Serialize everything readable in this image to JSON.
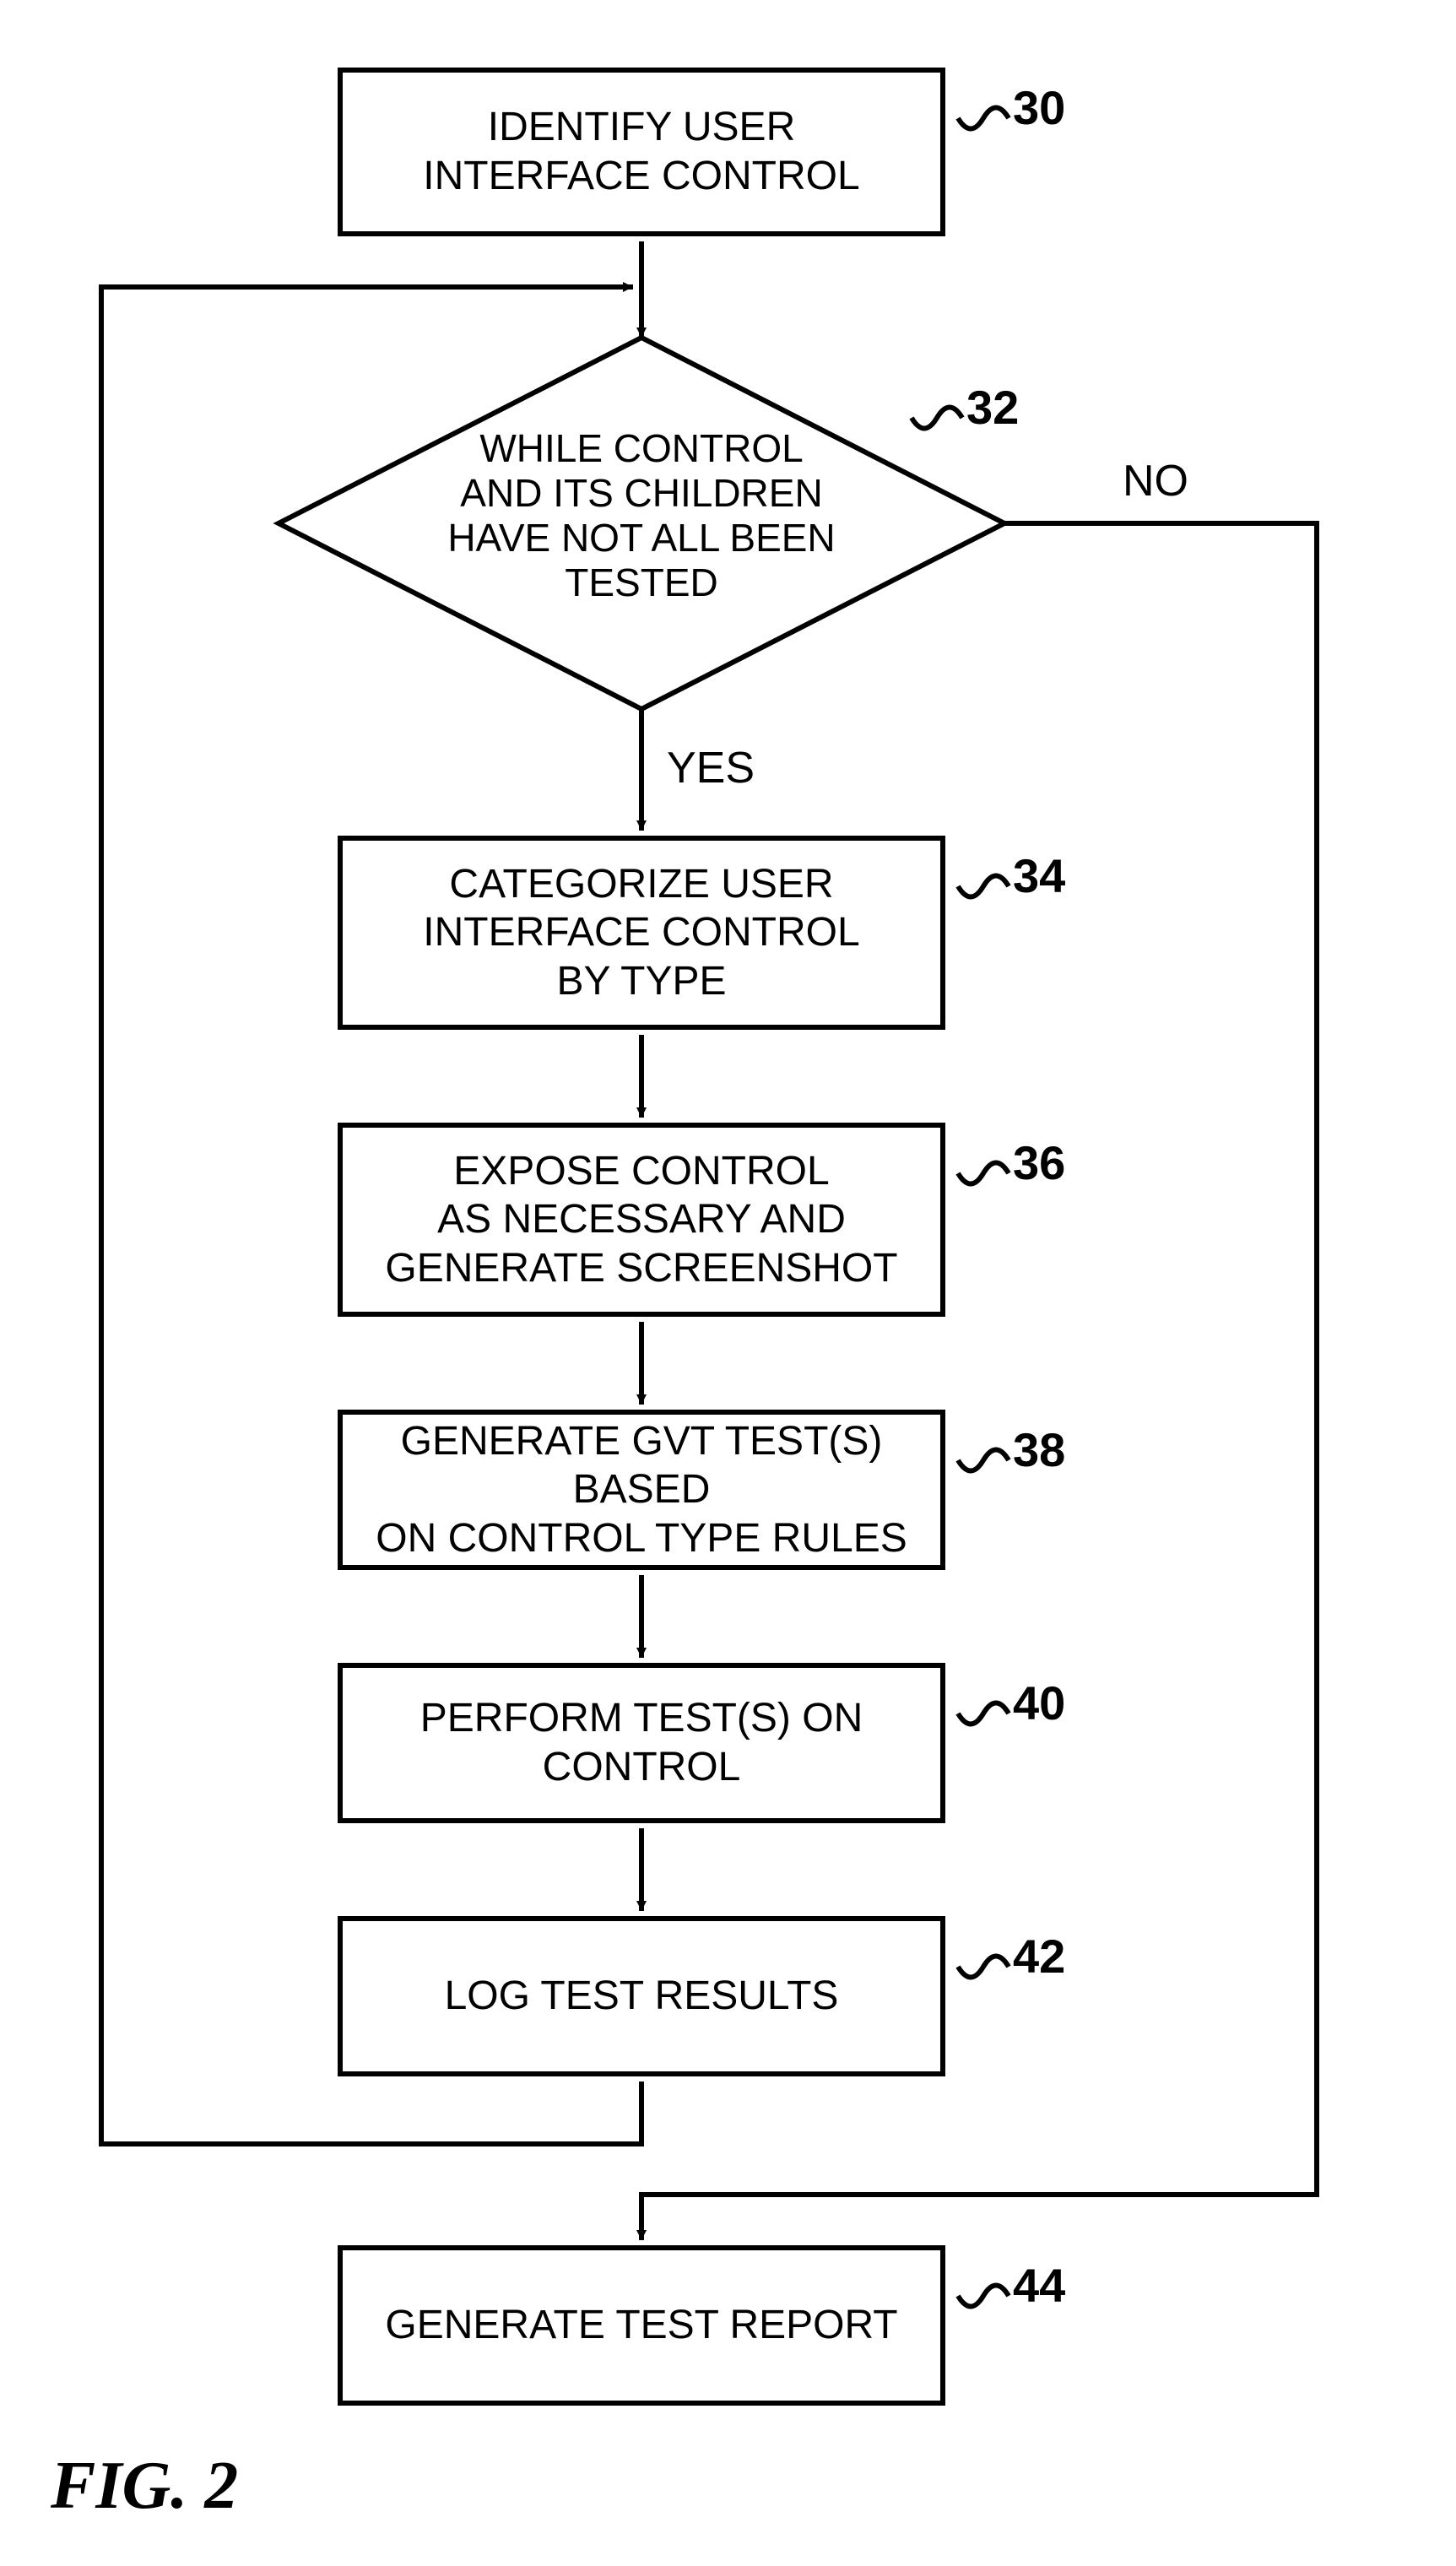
{
  "fig_caption": "FIG. 2",
  "labels": {
    "no": "NO",
    "yes": "YES"
  },
  "steps": {
    "s30": {
      "num": "30",
      "text": "IDENTIFY USER\nINTERFACE CONTROL"
    },
    "s32": {
      "num": "32",
      "text": "WHILE CONTROL\nAND ITS CHILDREN\nHAVE NOT ALL BEEN\nTESTED"
    },
    "s34": {
      "num": "34",
      "text": "CATEGORIZE USER\nINTERFACE CONTROL\nBY TYPE"
    },
    "s36": {
      "num": "36",
      "text": "EXPOSE CONTROL\nAS NECESSARY AND\nGENERATE SCREENSHOT"
    },
    "s38": {
      "num": "38",
      "text": "GENERATE GVT TEST(S) BASED\nON CONTROL TYPE RULES"
    },
    "s40": {
      "num": "40",
      "text": "PERFORM TEST(S) ON CONTROL"
    },
    "s42": {
      "num": "42",
      "text": "LOG TEST RESULTS"
    },
    "s44": {
      "num": "44",
      "text": "GENERATE TEST REPORT"
    }
  }
}
